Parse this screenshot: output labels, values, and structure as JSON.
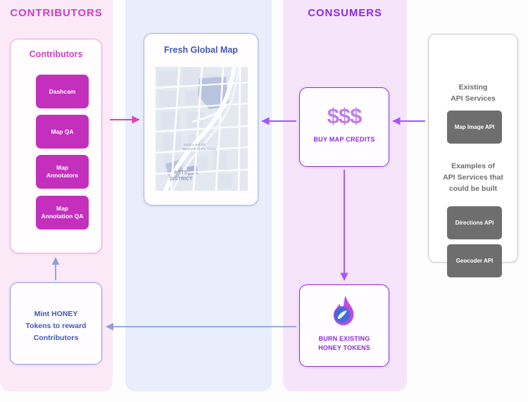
{
  "columns": {
    "contributors": {
      "title": "CONTRIBUTORS",
      "bg": "#fbe9f7",
      "accent": "#d13fc0"
    },
    "map": {
      "title": "",
      "bg": "#e8eefc",
      "accent": "#4257b2"
    },
    "consumers": {
      "title": "CONSUMERS",
      "bg": "#f6e4fb",
      "accent": "#8a2be2"
    }
  },
  "contributors_card": {
    "heading": "Contributors",
    "roles": [
      {
        "label": "Dashcam"
      },
      {
        "label": "Map QA"
      },
      {
        "label": "Map\nAnnotators"
      },
      {
        "label": "Map\nAnnotation QA"
      }
    ],
    "role_color": "#c42fbc"
  },
  "map_card": {
    "heading": "Fresh Global Map",
    "map_labels": {
      "poi": "Margot and Bill\nWinspear Opera House",
      "district": "ARTS\nDISTRICT"
    }
  },
  "money_card": {
    "glyph": "$$$",
    "label": "BUY MAP CREDITS"
  },
  "burn_card": {
    "icon": "flame-token-icon",
    "label": "BURN EXISTING\nHONEY TOKENS"
  },
  "mint_card": {
    "label": "Mint HONEY\nTokens to reward\nContributors"
  },
  "api_panel": {
    "headings": [
      "Existing\nAPI Services",
      "Examples of\nAPI Services that\ncould be built"
    ],
    "services": [
      {
        "label": "Map Image API"
      },
      {
        "label": "Directions API"
      },
      {
        "label": "Geocoder API"
      }
    ],
    "box_color": "#6e6e6e"
  },
  "arrows": [
    {
      "name": "contributors-to-map",
      "color": "#e043c0",
      "direction": "right"
    },
    {
      "name": "map-from-credits",
      "color": "#a855f7",
      "direction": "left"
    },
    {
      "name": "credits-from-api",
      "color": "#a855f7",
      "direction": "left"
    },
    {
      "name": "credits-to-burn",
      "color": "#a855f7",
      "direction": "down"
    },
    {
      "name": "burn-to-mint",
      "color": "#8e9ddf",
      "direction": "left"
    },
    {
      "name": "mint-to-contributors",
      "color": "#8e9ddf",
      "direction": "up"
    }
  ]
}
